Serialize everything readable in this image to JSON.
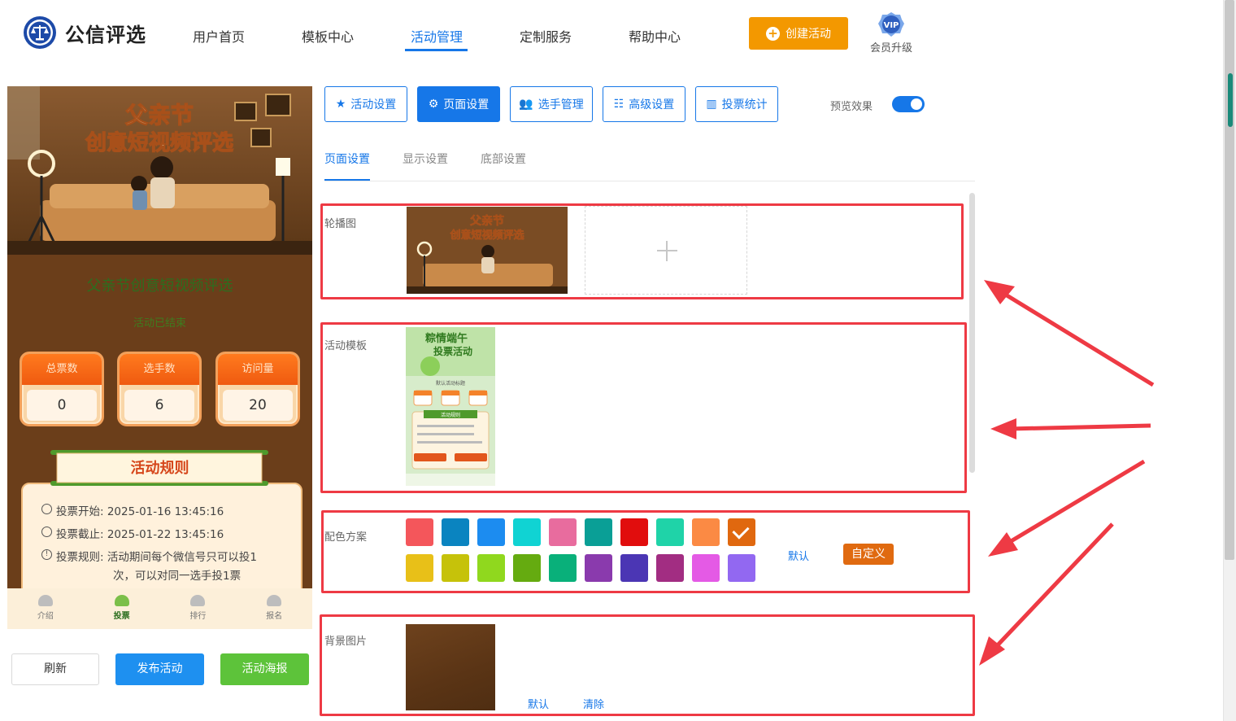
{
  "header": {
    "logo_text": "公信评选",
    "nav": [
      {
        "label": "用户首页"
      },
      {
        "label": "模板中心"
      },
      {
        "label": "活动管理"
      },
      {
        "label": "定制服务"
      },
      {
        "label": "帮助中心"
      }
    ],
    "active_nav": "活动管理",
    "create_button": "创建活动",
    "vip_badge": "VIP",
    "vip_label": "会员升级"
  },
  "preview": {
    "banner_title_line1": "父亲节",
    "banner_title_line2": "创意短视频评选",
    "activity_title": "父亲节创意短视频评选",
    "status": "活动已结束",
    "stats": [
      {
        "label": "总票数",
        "value": "0"
      },
      {
        "label": "选手数",
        "value": "6"
      },
      {
        "label": "访问量",
        "value": "20"
      }
    ],
    "rules_title": "活动规则",
    "rules": {
      "start": "投票开始:  2025-01-16 13:45:16",
      "end": "投票截止:  2025-01-22 13:45:16",
      "rule_line1": "投票规则:  活动期间每个微信号只可以投1",
      "rule_line2": "次，可以对同一选手投1票"
    },
    "tabbar": [
      {
        "label": "介绍"
      },
      {
        "label": "投票"
      },
      {
        "label": "排行"
      },
      {
        "label": "报名"
      }
    ]
  },
  "actions": {
    "refresh": "刷新",
    "publish": "发布活动",
    "poster": "活动海报"
  },
  "settings_tabs": [
    {
      "label": "活动设置",
      "icon": "star-icon"
    },
    {
      "label": "页面设置",
      "icon": "gear-icon"
    },
    {
      "label": "选手管理",
      "icon": "users-icon"
    },
    {
      "label": "高级设置",
      "icon": "sliders-icon"
    },
    {
      "label": "投票统计",
      "icon": "bar-chart-icon"
    }
  ],
  "active_settings_tab": "页面设置",
  "preview_toggle": {
    "label": "预览效果",
    "on": true
  },
  "sub_tabs": [
    {
      "label": "页面设置"
    },
    {
      "label": "显示设置"
    },
    {
      "label": "底部设置"
    }
  ],
  "sections": {
    "carousel": "轮播图",
    "template": "活动模板",
    "colors": "配色方案",
    "background": "背景图片"
  },
  "template_thumb": {
    "title_line1": "粽情端午",
    "title_line2": "投票活动",
    "subtitle": "默认活动标题",
    "rules": "活动规则"
  },
  "color_swatches": [
    "#f4565b",
    "#0a84c0",
    "#1c8cf0",
    "#10d3d3",
    "#e86c9e",
    "#0a9f96",
    "#e10d0d",
    "#1fd3a8",
    "#fb8a44",
    "#e0680f",
    "#e8c018",
    "#c6c20a",
    "#90d81e",
    "#65ab10",
    "#09b07a",
    "#8a3aad",
    "#4b36b4",
    "#a22d82",
    "#e45ae5",
    "#9268f1"
  ],
  "selected_color": "#e0680f",
  "color_links": {
    "default": "默认",
    "custom": "自定义"
  },
  "bg_links": {
    "default": "默认",
    "clear": "清除"
  },
  "highlight_color": "#ee3a44"
}
